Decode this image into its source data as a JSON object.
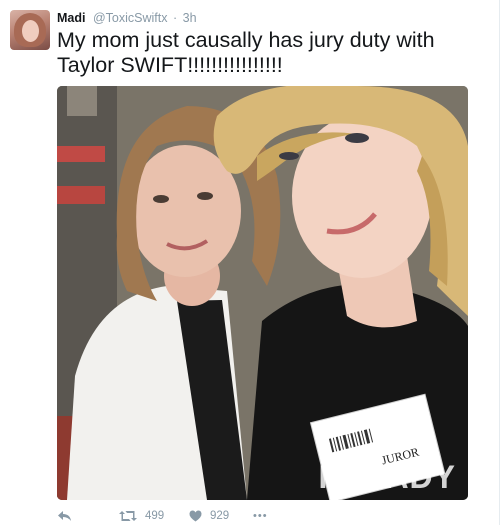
{
  "tweet": {
    "display_name": "Madi",
    "handle": "@ToxicSwiftx",
    "time": "3h",
    "separator": "·",
    "text": "My mom just causally has jury duty with Taylor SWIFT!!!!!!!!!!!!!!!!",
    "photo": {
      "badge_text": "JUROR",
      "watermark": "PCLADY"
    },
    "actions": {
      "retweets": "499",
      "likes": "929",
      "more_label": "•••"
    }
  },
  "colors": {
    "text": "#14171a",
    "muted": "#8899a6"
  },
  "icons": [
    "reply-icon",
    "retweet-icon",
    "like-icon",
    "more-icon"
  ]
}
